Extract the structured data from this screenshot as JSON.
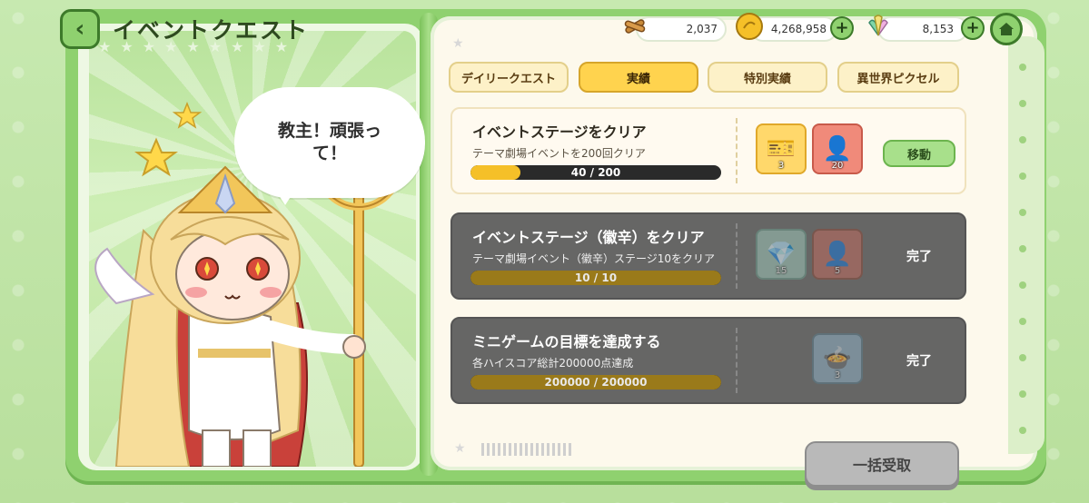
{
  "header": {
    "title": "イベントクエスト",
    "back_icon": "chevron-left-icon",
    "home_icon": "home-icon"
  },
  "currencies": [
    {
      "icon": "stick-icon",
      "value": "2,037",
      "has_plus": false
    },
    {
      "icon": "coin-icon",
      "value": "4,268,958",
      "has_plus": true
    },
    {
      "icon": "crystal-icon",
      "value": "8,153",
      "has_plus": true
    }
  ],
  "tabs": [
    {
      "label": "デイリークエスト",
      "active": false
    },
    {
      "label": "実績",
      "active": true
    },
    {
      "label": "特別実績",
      "active": false
    },
    {
      "label": "異世界ピクセル",
      "active": false
    }
  ],
  "speech": "教主！頑張って！",
  "quests": [
    {
      "title": "イベントステージをクリア",
      "desc": "テーマ劇場イベントを200回クリア",
      "progress_text": "40 / 200",
      "progress": 0.2,
      "rewards": [
        {
          "icon": "ticket-icon",
          "count": "3",
          "color": "#ffd86b"
        },
        {
          "icon": "character-shard-icon",
          "count": "20",
          "color": "#f08a7a"
        }
      ],
      "action": "移動",
      "state": "open"
    },
    {
      "title": "イベントステージ（徽辛）をクリア",
      "desc": "テーマ劇場イベント（徽辛）ステージ10をクリア",
      "progress_text": "10 / 10",
      "progress": 1.0,
      "rewards": [
        {
          "icon": "crystal-icon",
          "count": "15",
          "color": "#9ec6b8"
        },
        {
          "icon": "character-shard-icon",
          "count": "5",
          "color": "#c06a5f"
        }
      ],
      "action": "完了",
      "state": "done"
    },
    {
      "title": "ミニゲームの目標を達成する",
      "desc": "各ハイスコア総計200000点達成",
      "progress_text": "200000 / 200000",
      "progress": 1.0,
      "rewards": [
        {
          "icon": "cauldron-icon",
          "count": "3",
          "color": "#8fb0c4"
        }
      ],
      "action": "完了",
      "state": "done"
    }
  ],
  "footer": {
    "claim_all": "一括受取"
  }
}
